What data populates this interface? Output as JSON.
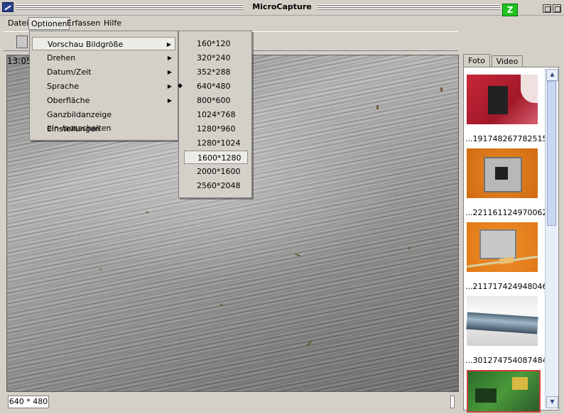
{
  "window": {
    "title": "MicroCapture"
  },
  "menubar": [
    "Datei",
    "Optionen",
    "Erfassen",
    "Hilfe"
  ],
  "optionen_menu": [
    {
      "label": "Vorschau Bildgröße",
      "submenu": true,
      "highlighted": true
    },
    {
      "label": "Drehen",
      "submenu": true
    },
    {
      "label": "Datum/Zeit",
      "submenu": true
    },
    {
      "label": "Sprache",
      "submenu": true
    },
    {
      "label": "Oberfläche",
      "submenu": true
    },
    {
      "label": "Ganzbildanzeige ein-/ausschalten",
      "submenu": false
    },
    {
      "label": "Einstellungen",
      "submenu": false
    }
  ],
  "size_menu": {
    "options": [
      "160*120",
      "320*240",
      "352*288",
      "640*480",
      "800*600",
      "1024*768",
      "1280*960",
      "1280*1024",
      "1600*1280",
      "2000*1600",
      "2560*2048"
    ],
    "selected": "640*480",
    "hovered": "1600*1280",
    "check_glyph": "◆"
  },
  "preview": {
    "timestamp": "13:05"
  },
  "statusbar": {
    "resolution": "640 * 480"
  },
  "gallery": {
    "tabs": [
      "Foto",
      "Video"
    ],
    "active_tab": "Foto",
    "items": [
      {
        "caption": "...191748267782515",
        "icon": "pcb-red-thumbnail"
      },
      {
        "caption": "...221161124970062",
        "icon": "component-orange-thumbnail"
      },
      {
        "caption": "...211717424948046",
        "icon": "resistor-orange-thumbnail"
      },
      {
        "caption": "...301274754087484",
        "icon": "metal-rod-thumbnail"
      },
      {
        "caption": "",
        "icon": "pcb-green-thumbnail"
      }
    ]
  },
  "colors": {
    "window_bg": "#d4d0c8",
    "zone_icon": "#1fc41f",
    "scrollbar": "#c8d8f0"
  }
}
